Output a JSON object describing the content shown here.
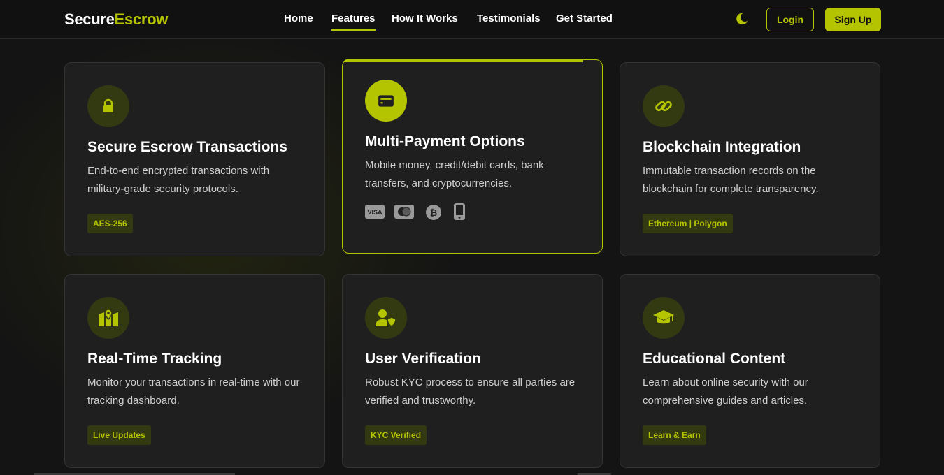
{
  "nav": {
    "logo_part1": "Secure",
    "logo_part2": "Escrow",
    "links": [
      {
        "label": "Home"
      },
      {
        "label": "Features"
      },
      {
        "label": "How It Works"
      },
      {
        "label": "Testimonials"
      },
      {
        "label": "Get Started"
      }
    ],
    "active_link": "Features",
    "theme_icon": "moon-icon",
    "login_label": "Login",
    "signup_label": "Sign Up"
  },
  "colors": {
    "accent": "#b5c400",
    "background": "#141414",
    "card": "#1f1f1f",
    "icon_bg": "#333a12"
  },
  "features": [
    {
      "icon": "lock-icon",
      "title": "Secure Escrow Transactions",
      "description": "End-to-end encrypted transactions with military-grade security protocols.",
      "tag": "AES-256"
    },
    {
      "icon": "wallet-icon",
      "title": "Multi-Payment Options",
      "description": "Mobile money, credit/debit cards, bank transfers, and cryptocurrencies.",
      "payment_icons": [
        "visa-icon",
        "mastercard-icon",
        "bitcoin-icon",
        "mobile-phone-icon"
      ]
    },
    {
      "icon": "link-icon",
      "title": "Blockchain Integration",
      "description": "Immutable transaction records on the blockchain for complete transparency.",
      "tag": "Ethereum | Polygon"
    },
    {
      "icon": "map-marker-icon",
      "title": "Real-Time Tracking",
      "description": "Monitor your transactions in real-time with our tracking dashboard.",
      "tag": "Live Updates"
    },
    {
      "icon": "user-shield-icon",
      "title": "User Verification",
      "description": "Robust KYC process to ensure all parties are verified and trustworthy.",
      "tag": "KYC Verified"
    },
    {
      "icon": "graduation-cap-icon",
      "title": "Educational Content",
      "description": "Learn about online security with our comprehensive guides and articles.",
      "tag": "Learn & Earn"
    }
  ]
}
